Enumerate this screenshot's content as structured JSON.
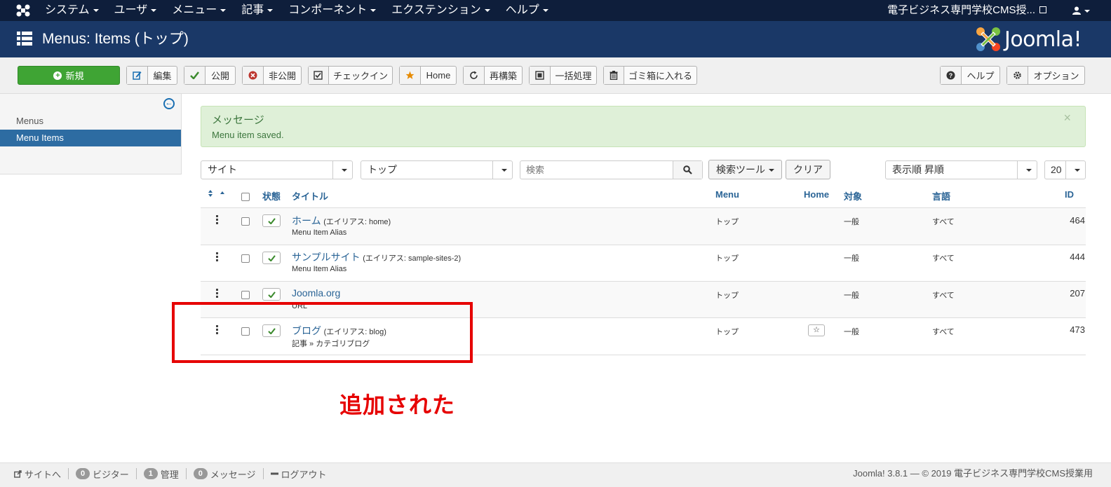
{
  "topnav": {
    "items": [
      "システム",
      "ユーザ",
      "メニュー",
      "記事",
      "コンポーネント",
      "エクステンション",
      "ヘルプ"
    ],
    "site_name": "電子ビジネス専門学校CMS授...",
    "user_icon": "user-icon"
  },
  "header": {
    "title": "Menus: Items (トップ)",
    "brand": "Joomla!"
  },
  "toolbar": {
    "new": "新規",
    "edit": "編集",
    "publish": "公開",
    "unpublish": "非公開",
    "checkin": "チェックイン",
    "home": "Home",
    "rebuild": "再構築",
    "batch": "一括処理",
    "trash": "ゴミ箱に入れる",
    "help": "ヘルプ",
    "options": "オプション"
  },
  "sidebar": {
    "items": [
      {
        "label": "Menus",
        "active": false
      },
      {
        "label": "Menu Items",
        "active": true
      }
    ]
  },
  "message": {
    "heading": "メッセージ",
    "text": "Menu item saved.",
    "close": "×"
  },
  "filters": {
    "client": "サイト",
    "menu": "トップ",
    "search_placeholder": "検索",
    "search_tools": "検索ツール",
    "clear": "クリア",
    "ordering": "表示順 昇順",
    "limit": "20"
  },
  "table": {
    "headers": {
      "status": "状態",
      "title": "タイトル",
      "menu": "Menu",
      "home": "Home",
      "access": "対象",
      "language": "言語",
      "id": "ID"
    },
    "rows": [
      {
        "title": "ホーム",
        "alias": "(エイリアス: home)",
        "sub": "Menu Item Alias",
        "menu": "トップ",
        "access": "一般",
        "language": "すべて",
        "id": "464",
        "home_star": false
      },
      {
        "title": "サンプルサイト",
        "alias": "(エイリアス: sample-sites-2)",
        "sub": "Menu Item Alias",
        "menu": "トップ",
        "access": "一般",
        "language": "すべて",
        "id": "444",
        "home_star": false
      },
      {
        "title": "Joomla.org",
        "alias": "",
        "sub": "URL",
        "menu": "トップ",
        "access": "一般",
        "language": "すべて",
        "id": "207",
        "home_star": false
      },
      {
        "title": "ブログ",
        "alias": "(エイリアス: blog)",
        "sub": "記事 » カテゴリブログ",
        "menu": "トップ",
        "access": "一般",
        "language": "すべて",
        "id": "473",
        "home_star": true
      }
    ]
  },
  "annotation": {
    "text": "追加された",
    "color": "#e60000"
  },
  "footer": {
    "site": "サイトへ",
    "visitors_count": "0",
    "visitors": "ビジター",
    "admins_count": "1",
    "admins": "管理",
    "messages_count": "0",
    "messages": "メッセージ",
    "logout": "ログアウト",
    "version": "Joomla! 3.8.1 — © 2019 電子ビジネス専門学校CMS授業用"
  }
}
